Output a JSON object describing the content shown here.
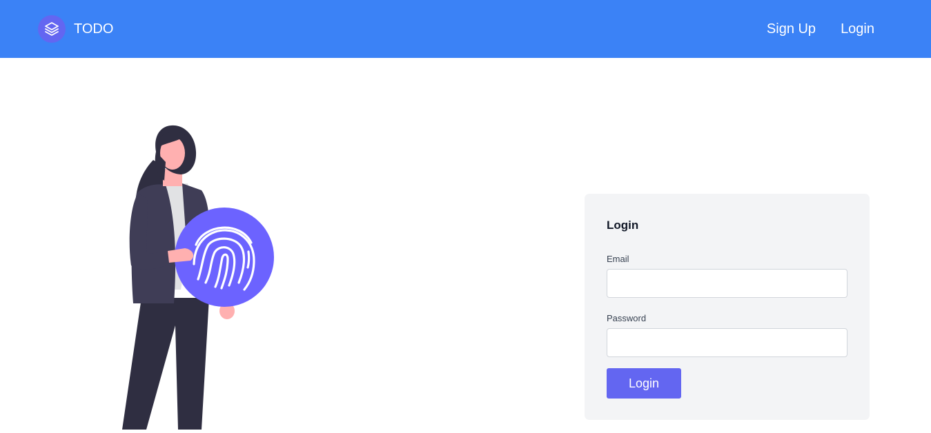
{
  "navbar": {
    "brand_text": "TODO",
    "brand_icon": "layers-icon",
    "links": [
      {
        "label": "Sign Up"
      },
      {
        "label": "Login"
      }
    ],
    "background": "#3b82f6"
  },
  "illustration": {
    "subject": "woman-holding-fingerprint",
    "accent": "#6c63ff"
  },
  "login_form": {
    "title": "Login",
    "email_label": "Email",
    "email_value": "",
    "password_label": "Password",
    "password_value": "",
    "submit_label": "Login",
    "accent": "#6366f1"
  }
}
